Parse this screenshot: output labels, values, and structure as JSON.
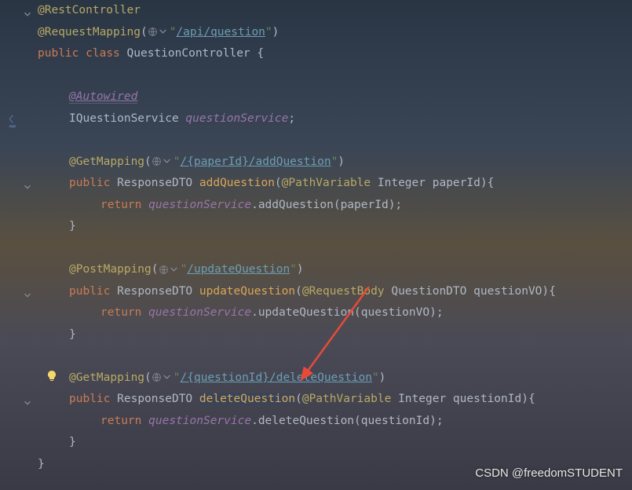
{
  "code": {
    "restController": "@RestController",
    "requestMapping": "@RequestMapping",
    "apiQuestion": "/api/question",
    "publicKw": "public",
    "classKw": "class",
    "className": "QuestionController",
    "braceOpen": "{",
    "braceClose": "}",
    "autowired": "@Autowired",
    "iQuestionService": "IQuestionService",
    "questionService": "questionService",
    "semi": ";",
    "getMapping": "@GetMapping",
    "postMapping": "@PostMapping",
    "addQuestionPath": "/{paperId}/addQuestion",
    "updateQuestionPath": "/updateQuestion",
    "deleteQuestionPath": "/{questionId}/deleteQuestion",
    "responseDto": "ResponseDTO",
    "addQuestion": "addQuestion",
    "updateQuestion": "updateQuestion",
    "deleteQuestion": "deleteQuestion",
    "pathVariable": "@PathVariable",
    "requestBody": "@RequestBody",
    "integer": "Integer",
    "paperId": "paperId",
    "questionDto": "QuestionDTO",
    "questionVo": "questionVO",
    "questionId": "questionId",
    "returnKw": "return",
    "quote": "\"",
    "parenOpen": "(",
    "parenClose": ")",
    "braceOpenInline": "{",
    "braceCloseInline": "}",
    "dot": "."
  },
  "watermark": "CSDN @freedomSTUDENT",
  "chart_data": null
}
